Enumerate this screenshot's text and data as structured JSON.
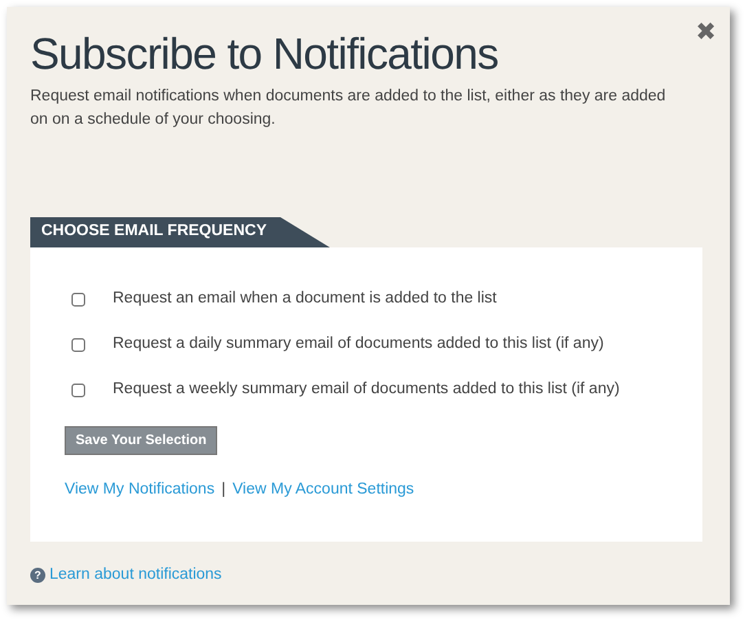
{
  "dialog": {
    "title": "Subscribe to Notifications",
    "description": "Request email notifications when documents are added to the list, either as they are added on on a schedule of your choosing.",
    "close": "✖"
  },
  "section": {
    "heading": "CHOOSE EMAIL FREQUENCY",
    "options": [
      {
        "label": "Request an email when a document is added to the list",
        "checked": false
      },
      {
        "label": "Request a daily summary email of documents added to this list (if any)",
        "checked": false
      },
      {
        "label": "Request a weekly summary email of documents added to this list (if any)",
        "checked": false
      }
    ],
    "button": "Save Your Selection",
    "links": [
      "View My Notifications",
      "View My Account Settings"
    ],
    "separator": "|"
  },
  "footer": {
    "help_link": "Learn about notifications",
    "help_icon": "?"
  }
}
